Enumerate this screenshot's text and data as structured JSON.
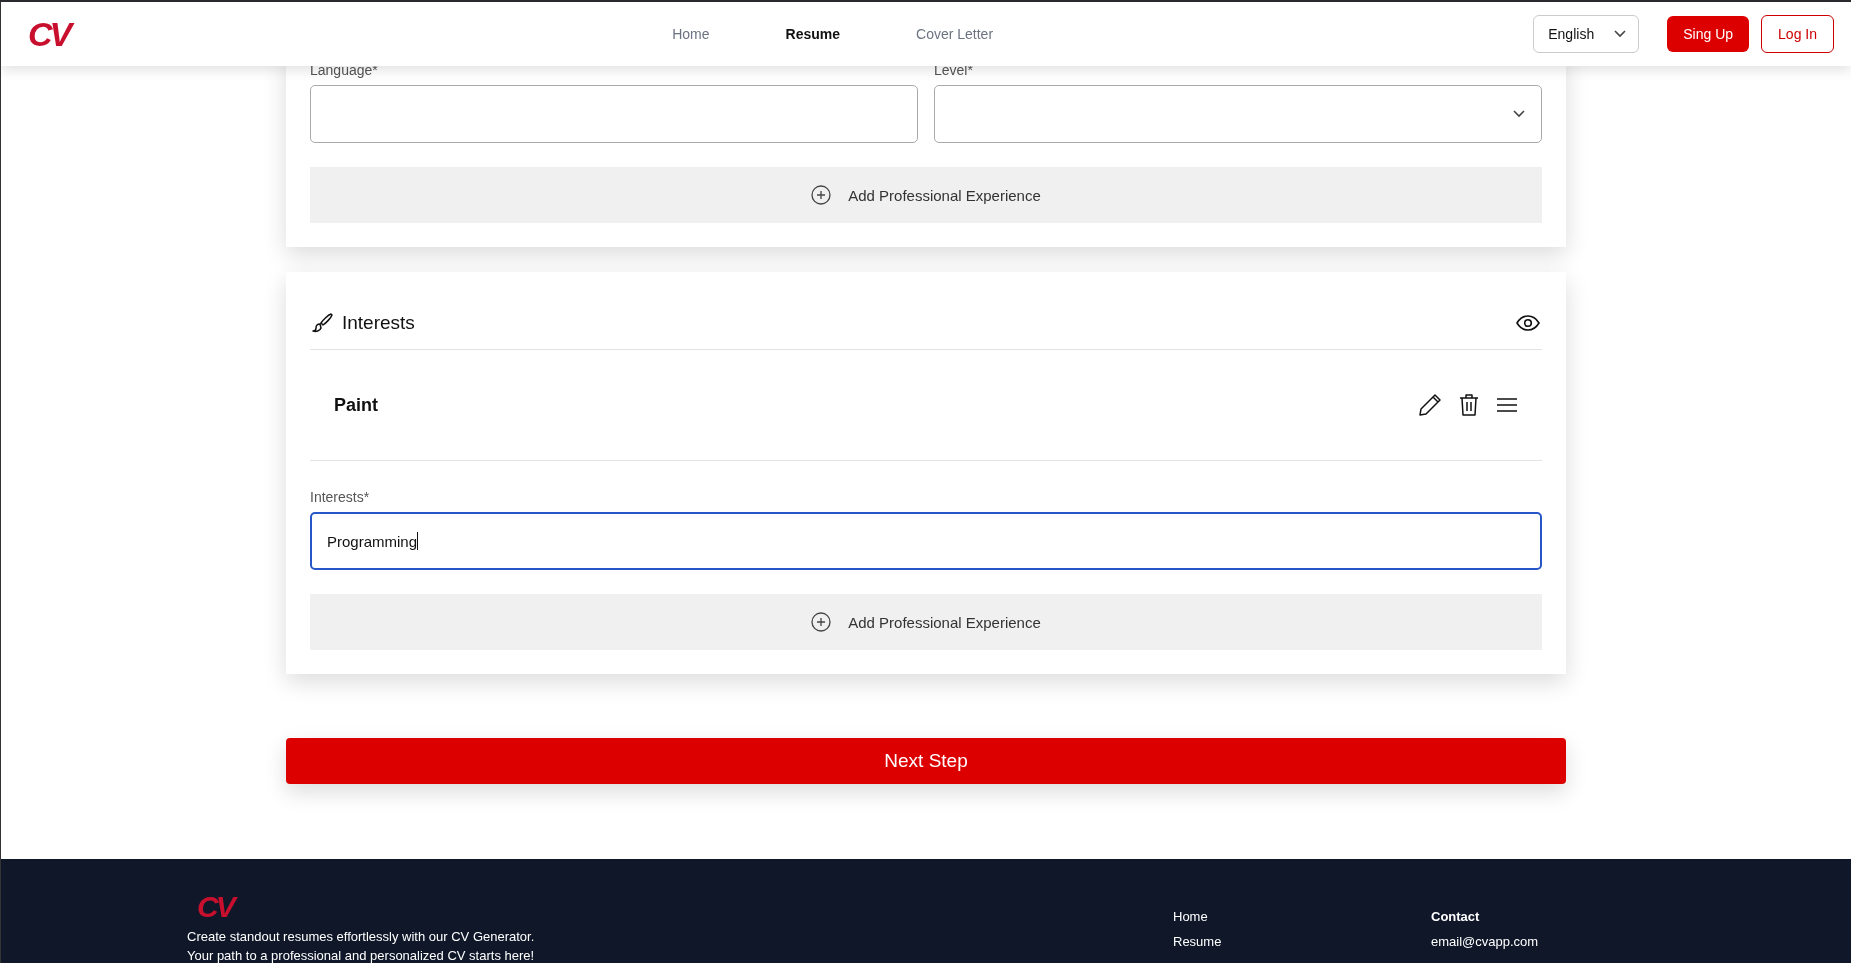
{
  "header": {
    "logo": "CV",
    "nav": [
      {
        "label": "Home",
        "selected": false
      },
      {
        "label": "Resume",
        "selected": true
      },
      {
        "label": "Cover Letter",
        "selected": false
      }
    ],
    "language": "English",
    "signup": "Sing Up",
    "login": "Log In"
  },
  "language_section": {
    "fields": [
      {
        "label": "Language*",
        "kind": "text"
      },
      {
        "label": "Level*",
        "kind": "select"
      }
    ],
    "add_button": "Add Professional Experience"
  },
  "interests_section": {
    "title": "Interests",
    "items": [
      {
        "name": "Paint"
      }
    ],
    "field": {
      "label": "Interests*",
      "value": "Programming",
      "focused": true
    },
    "add_button": "Add Professional Experience"
  },
  "next_button": "Next Step",
  "footer": {
    "logo": "CV",
    "text": [
      "Create standout resumes effortlessly with our CV Generator.",
      "Your path to a professional and personalized CV starts here!"
    ],
    "links": [
      "Home",
      "Resume"
    ],
    "contact_title": "Contact",
    "contact": [
      "email@cvapp.com"
    ]
  }
}
